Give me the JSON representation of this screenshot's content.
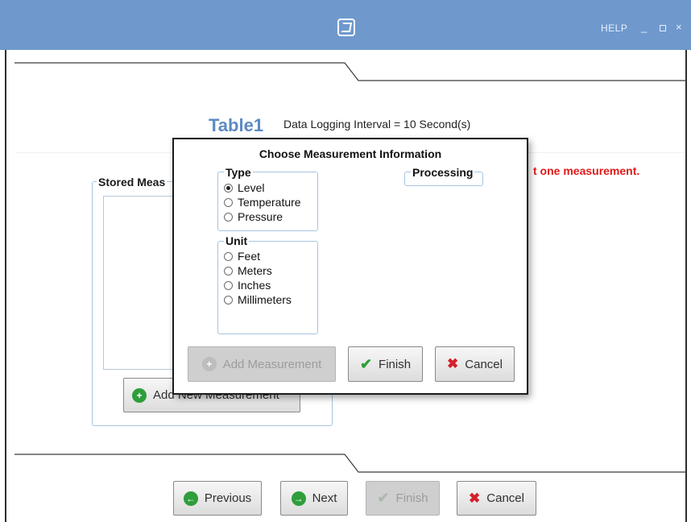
{
  "titlebar": {
    "logo_icon": "campbell-logo-icon",
    "help_label": "HELP",
    "minimize_glyph": "_",
    "maximize_glyph": "",
    "close_glyph": "×",
    "color": "#6f99cd"
  },
  "page": {
    "table_title": "Table1",
    "interval_text": "Data Logging Interval = 10 Second(s)",
    "error_text": "t one measurement.",
    "stored_legend": "Stored Meas",
    "add_new_label": "Add New Measurement"
  },
  "footer": {
    "previous_label": "Previous",
    "next_label": "Next",
    "finish_label": "Finish",
    "cancel_label": "Cancel"
  },
  "dialog": {
    "title": "Choose Measurement Information",
    "type": {
      "legend": "Type",
      "options": [
        "Level",
        "Temperature",
        "Pressure"
      ],
      "selected": "Level"
    },
    "unit": {
      "legend": "Unit",
      "options": [
        "Feet",
        "Meters",
        "Inches",
        "Millimeters"
      ],
      "selected": null
    },
    "processing": {
      "legend": "Processing"
    },
    "buttons": {
      "add_measurement": "Add Measurement",
      "finish": "Finish",
      "cancel": "Cancel"
    }
  },
  "colors": {
    "accent": "#5b8ac5",
    "error": "#e01a1a",
    "group_border": "#a8c4e2"
  }
}
